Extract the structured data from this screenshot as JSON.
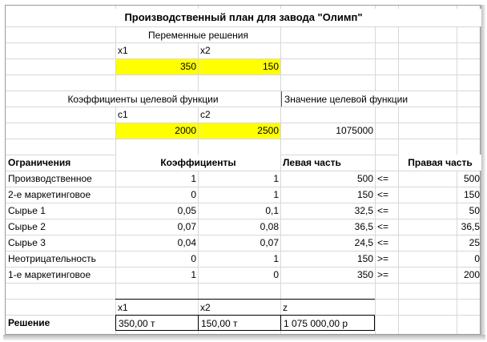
{
  "title": "Производственный план для завода \"Олимп\"",
  "variables": {
    "label": "Переменные решения",
    "x1_name": "x1",
    "x2_name": "x2",
    "x1_value": "350",
    "x2_value": "150"
  },
  "objective": {
    "coef_label": "Коэффициенты целевой функции",
    "value_label": "Значение целевой функции",
    "c1_name": "c1",
    "c2_name": "c2",
    "c1_value": "2000",
    "c2_value": "2500",
    "value": "1075000"
  },
  "constraints": {
    "headers": {
      "name": "Ограничения",
      "coefs": "Коэффициенты",
      "lhs": "Левая часть",
      "rhs": "Правая часть"
    },
    "rows": [
      {
        "name": "Производственное",
        "a1": "1",
        "a2": "1",
        "lhs": "500",
        "sign": "<=",
        "rhs": "500"
      },
      {
        "name": "2-е маркетинговое",
        "a1": "0",
        "a2": "1",
        "lhs": "150",
        "sign": "<=",
        "rhs": "150"
      },
      {
        "name": "Сырье 1",
        "a1": "0,05",
        "a2": "0,1",
        "lhs": "32,5",
        "sign": "<=",
        "rhs": "50"
      },
      {
        "name": "Сырье 2",
        "a1": "0,07",
        "a2": "0,08",
        "lhs": "36,5",
        "sign": "<=",
        "rhs": "36,5"
      },
      {
        "name": "Сырье 3",
        "a1": "0,04",
        "a2": "0,07",
        "lhs": "24,5",
        "sign": "<=",
        "rhs": "25"
      },
      {
        "name": "Неотрицательность",
        "a1": "0",
        "a2": "1",
        "lhs": "150",
        "sign": ">=",
        "rhs": "0"
      },
      {
        "name": "1-е маркетинговое",
        "a1": "1",
        "a2": "0",
        "lhs": "350",
        "sign": ">=",
        "rhs": "200"
      }
    ]
  },
  "solution": {
    "label": "Решение",
    "x1_name": "x1",
    "x2_name": "x2",
    "z_name": "z",
    "x1": "350,00 т",
    "x2": "150,00 т",
    "z": "1 075 000,00 р"
  },
  "colors": {
    "highlight": "#ffff00",
    "grid": "#d7d7d7"
  }
}
